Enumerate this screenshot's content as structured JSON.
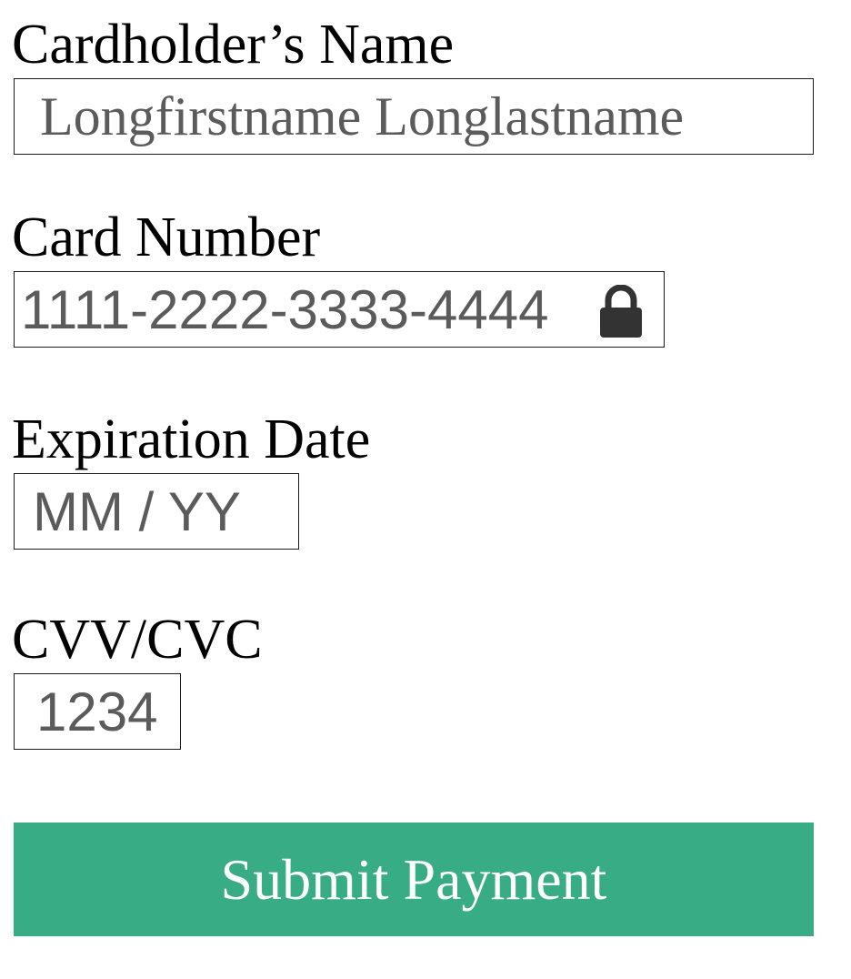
{
  "form": {
    "name": {
      "label": "Cardholder’s Name",
      "placeholder": "Longfirstname Longlastname",
      "value": ""
    },
    "card_number": {
      "label": "Card Number",
      "placeholder": "1111-2222-3333-4444",
      "value": "",
      "icon": "lock-icon"
    },
    "expiration": {
      "label": "Expiration Date",
      "placeholder": "MM / YY",
      "value": ""
    },
    "cvv": {
      "label": "CVV/CVC",
      "placeholder": "1234",
      "value": ""
    },
    "submit_label": "Submit Payment"
  },
  "colors": {
    "accent": "#38ac84",
    "input_text": "#5b5b5b",
    "icon": "#333333"
  }
}
